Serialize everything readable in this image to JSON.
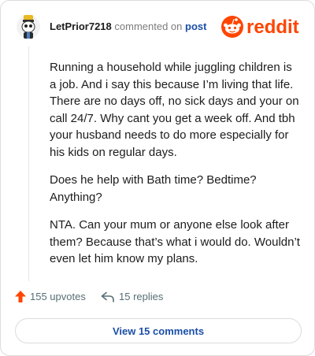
{
  "comment": {
    "author": "LetPrior7218",
    "action_text": "commented on",
    "target_link": "post",
    "paragraphs": [
      "Running a household while juggling children is a job. And i say this because I’m living that life. There are no days off, no sick days and your on call 24/7. Why cant you get a week off. And tbh your husband needs to do more especially for his kids on regular days.",
      "Does he help with Bath time? Bedtime? Anything?",
      "NTA. Can your mum or anyone else look after them? Because that’s what i would do. Wouldn’t even let him know my plans."
    ]
  },
  "brand": {
    "name": "reddit",
    "color": "#FF4500"
  },
  "stats": {
    "upvotes_label": "155 upvotes",
    "replies_label": "15 replies"
  },
  "footer": {
    "view_comments_label": "View 15 comments"
  },
  "icons": {
    "avatar": "avatar-icon",
    "upvote": "upvote-arrow-icon",
    "reply": "reply-arrow-icon",
    "logo": "reddit-logo-icon"
  },
  "colors": {
    "link": "#1B4FA8",
    "muted": "#576F76",
    "upvote": "#FF4500"
  }
}
